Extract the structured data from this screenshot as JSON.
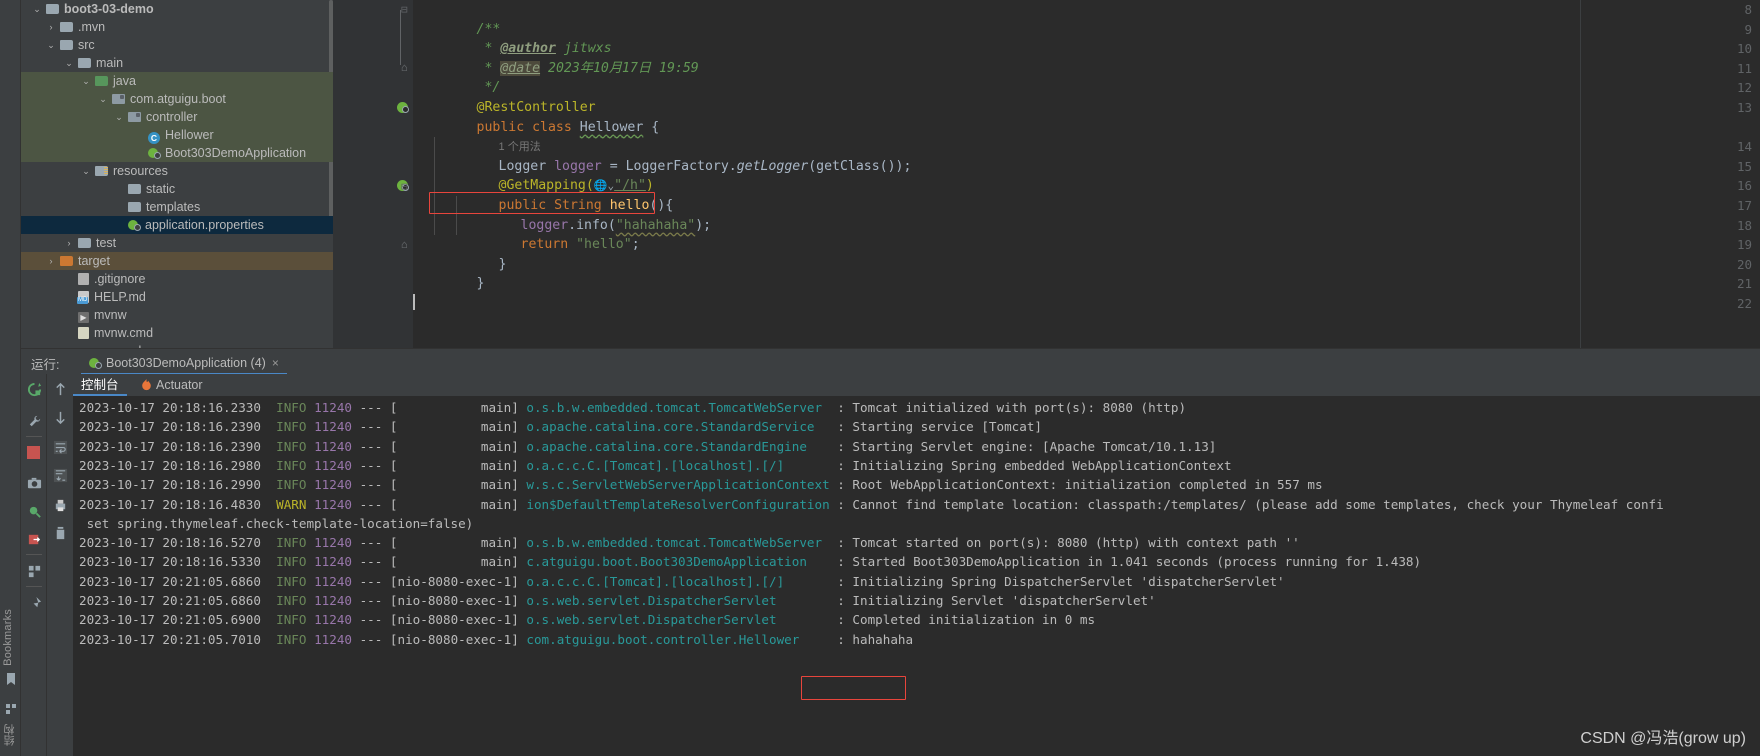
{
  "ide": {
    "left_rail": {
      "bookmarks_label": "Bookmarks",
      "structure_label": "结构"
    },
    "project_tree": {
      "items": [
        {
          "label": "boot3-03-demo",
          "indent": 46,
          "arrow": "v",
          "icon": "module-icon",
          "bold": true,
          "state": "none"
        },
        {
          "label": ".mvn",
          "indent": 60,
          "arrow": ">",
          "icon": "folder-grey-icon",
          "state": "none"
        },
        {
          "label": "src",
          "indent": 60,
          "arrow": "v",
          "icon": "folder-grey-icon",
          "state": "none"
        },
        {
          "label": "main",
          "indent": 78,
          "arrow": "v",
          "icon": "folder-grey-icon",
          "state": "none"
        },
        {
          "label": "java",
          "indent": 95,
          "arrow": "v",
          "icon": "folder-green-icon",
          "state": "green"
        },
        {
          "label": "com.atguigu.boot",
          "indent": 112,
          "arrow": "v",
          "icon": "package-icon",
          "state": "green"
        },
        {
          "label": "controller",
          "indent": 128,
          "arrow": "v",
          "icon": "package-icon",
          "state": "green"
        },
        {
          "label": "Hellower",
          "indent": 148,
          "arrow": "",
          "icon": "java-class-icon",
          "state": "green"
        },
        {
          "label": "Boot303DemoApplication",
          "indent": 148,
          "arrow": "",
          "icon": "spring-boot-icon",
          "state": "green"
        },
        {
          "label": "resources",
          "indent": 95,
          "arrow": "v",
          "icon": "resources-folder-icon",
          "state": "none"
        },
        {
          "label": "static",
          "indent": 128,
          "arrow": "",
          "icon": "folder-grey-icon",
          "state": "none"
        },
        {
          "label": "templates",
          "indent": 128,
          "arrow": "",
          "icon": "folder-grey-icon",
          "state": "none"
        },
        {
          "label": "application.properties",
          "indent": 128,
          "arrow": "",
          "icon": "spring-properties-icon",
          "state": "blue"
        },
        {
          "label": "test",
          "indent": 78,
          "arrow": ">",
          "icon": "folder-grey-icon",
          "state": "none"
        },
        {
          "label": "target",
          "indent": 60,
          "arrow": ">",
          "icon": "folder-orange-icon",
          "state": "brown"
        },
        {
          "label": ".gitignore",
          "indent": 78,
          "arrow": "",
          "icon": "gitignore-file-icon",
          "state": "none"
        },
        {
          "label": "HELP.md",
          "indent": 78,
          "arrow": "",
          "icon": "markdown-file-icon",
          "state": "none"
        },
        {
          "label": "mvnw",
          "indent": 78,
          "arrow": "",
          "icon": "script-file-icon",
          "state": "none"
        },
        {
          "label": "mvnw.cmd",
          "indent": 78,
          "arrow": "",
          "icon": "cmd-file-icon",
          "state": "none"
        },
        {
          "label": "pom.xml",
          "indent": 78,
          "arrow": "",
          "icon": "maven-xml-icon",
          "state": "none"
        }
      ]
    },
    "editor": {
      "line_numbers": [
        "8",
        "9",
        "10",
        "11",
        "12",
        "13",
        "14",
        "15",
        "16",
        "17",
        "18",
        "19",
        "20",
        "21",
        "22"
      ],
      "code": {
        "l8_comment": "/**",
        "l9_star": " * ",
        "l9_tag": "@author",
        "l9_text": " jitwxs",
        "l10_star": " * ",
        "l10_tag": "@date",
        "l10_text": " 2023年10月17日 19:59",
        "l11": " */",
        "l12_anno": "@RestController",
        "l13_kw1": "public class ",
        "l13_cls": "Hellower",
        "l13_brace": " {",
        "l13_usage": "1 个用法",
        "l14_type": "Logger ",
        "l14_field": "logger",
        "l14_rest": " = LoggerFactory.",
        "l14_mth": "getLogger",
        "l14_tail": "(getClass());",
        "l15_anno": "@GetMapping(",
        "l15_str": "\"/h\"",
        "l15_tail": ")",
        "l16_kw": "public ",
        "l16_type": "String ",
        "l16_mth": "hello",
        "l16_tail": "(){",
        "l17_field": "logger",
        "l17_call": ".info(",
        "l17_str": "\"hahahaha\"",
        "l17_tail": ");",
        "l18_kw": "return ",
        "l18_str": "\"hello\"",
        "l18_tail": ";",
        "l19": "}",
        "l20": "}"
      }
    },
    "run_window": {
      "title": "运行:",
      "config_tab": "Boot303DemoApplication (4)",
      "close_glyph": "×",
      "tabs": [
        {
          "label": "控制台",
          "active": true,
          "icon": "console-icon"
        },
        {
          "label": "Actuator",
          "active": false,
          "icon": "actuator-flame-icon"
        }
      ],
      "console_lines": [
        {
          "date": "2023-10-17 20:18:16.233",
          "level": "INFO",
          "pid": "11240",
          "thread": "main",
          "logger": "o.s.b.w.embedded.tomcat.TomcatWebServer",
          "msg": "Tomcat initialized with port(s): 8080 (http)"
        },
        {
          "date": "2023-10-17 20:18:16.239",
          "level": "INFO",
          "pid": "11240",
          "thread": "main",
          "logger": "o.apache.catalina.core.StandardService",
          "msg": "Starting service [Tomcat]"
        },
        {
          "date": "2023-10-17 20:18:16.239",
          "level": "INFO",
          "pid": "11240",
          "thread": "main",
          "logger": "o.apache.catalina.core.StandardEngine",
          "msg": "Starting Servlet engine: [Apache Tomcat/10.1.13]"
        },
        {
          "date": "2023-10-17 20:18:16.298",
          "level": "INFO",
          "pid": "11240",
          "thread": "main",
          "logger": "o.a.c.c.C.[Tomcat].[localhost].[/]",
          "msg": "Initializing Spring embedded WebApplicationContext"
        },
        {
          "date": "2023-10-17 20:18:16.299",
          "level": "INFO",
          "pid": "11240",
          "thread": "main",
          "logger": "w.s.c.ServletWebServerApplicationContext",
          "msg": "Root WebApplicationContext: initialization completed in 557 ms"
        },
        {
          "date": "2023-10-17 20:18:16.483",
          "level": "WARN",
          "pid": "11240",
          "thread": "main",
          "logger": "ion$DefaultTemplateResolverConfiguration",
          "msg": "Cannot find template location: classpath:/templates/ (please add some templates, check your Thymeleaf confi"
        },
        {
          "continuation": " set spring.thymeleaf.check-template-location=false)"
        },
        {
          "date": "2023-10-17 20:18:16.527",
          "level": "INFO",
          "pid": "11240",
          "thread": "main",
          "logger": "o.s.b.w.embedded.tomcat.TomcatWebServer",
          "msg": "Tomcat started on port(s): 8080 (http) with context path ''"
        },
        {
          "date": "2023-10-17 20:18:16.533",
          "level": "INFO",
          "pid": "11240",
          "thread": "main",
          "logger": "c.atguigu.boot.Boot303DemoApplication",
          "msg": "Started Boot303DemoApplication in 1.041 seconds (process running for 1.438)"
        },
        {
          "date": "2023-10-17 20:21:05.686",
          "level": "INFO",
          "pid": "11240",
          "thread": "nio-8080-exec-1",
          "logger": "o.a.c.c.C.[Tomcat].[localhost].[/]",
          "msg": "Initializing Spring DispatcherServlet 'dispatcherServlet'"
        },
        {
          "date": "2023-10-17 20:21:05.686",
          "level": "INFO",
          "pid": "11240",
          "thread": "nio-8080-exec-1",
          "logger": "o.s.web.servlet.DispatcherServlet",
          "msg": "Initializing Servlet 'dispatcherServlet'"
        },
        {
          "date": "2023-10-17 20:21:05.690",
          "level": "INFO",
          "pid": "11240",
          "thread": "nio-8080-exec-1",
          "logger": "o.s.web.servlet.DispatcherServlet",
          "msg": "Completed initialization in 0 ms"
        },
        {
          "date": "2023-10-17 20:21:05.701",
          "level": "INFO",
          "pid": "11240",
          "thread": "nio-8080-exec-1",
          "logger": "com.atguigu.boot.controller.Hellower",
          "msg": "hahahaha",
          "highlight": true
        }
      ]
    },
    "watermark": "CSDN @冯浩(grow up)",
    "colors": {
      "highlight_box": "#e8453c",
      "accent_tab": "#4a88c7",
      "selection_green": "#4c5543",
      "selection_blue": "#0d293e",
      "selection_brown": "#5b4f3a",
      "editor_bg": "#2b2b2b",
      "panel_bg": "#3c3f41"
    }
  }
}
